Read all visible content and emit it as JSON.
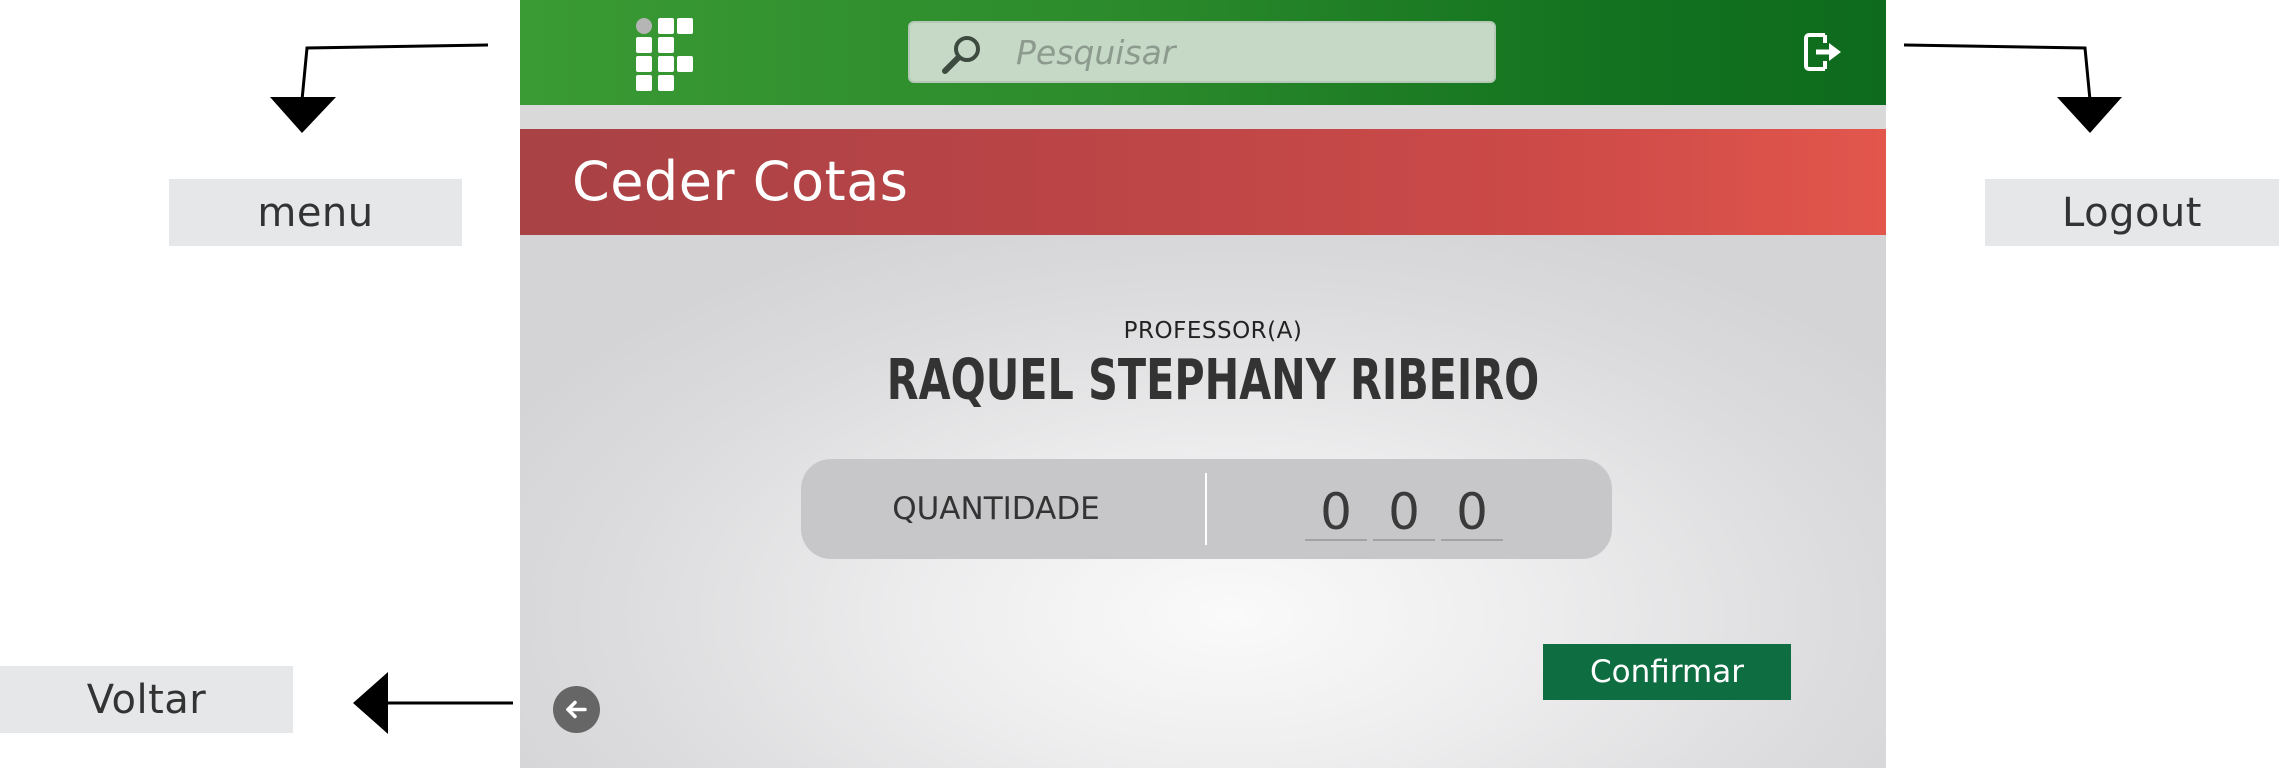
{
  "annotations": {
    "menu_label": "menu",
    "logout_label": "Logout",
    "back_label": "Voltar"
  },
  "header": {
    "search_placeholder": "Pesquisar",
    "logo_icon": "institution-logo-icon",
    "search_icon": "search-icon",
    "logout_icon": "logout-icon"
  },
  "page": {
    "title": "Ceder Cotas"
  },
  "professor": {
    "role_label": "PROFESSOR(A)",
    "name": "RAQUEL STEPHANY RIBEIRO"
  },
  "quantity": {
    "label": "QUANTIDADE",
    "digits": [
      "0",
      "0",
      "0"
    ]
  },
  "actions": {
    "confirm_label": "Confirmar",
    "back_icon": "arrow-left-icon"
  },
  "colors": {
    "header_green": "#2b8a2b",
    "title_red": "#c04547",
    "confirm_green": "#0e6e42"
  }
}
